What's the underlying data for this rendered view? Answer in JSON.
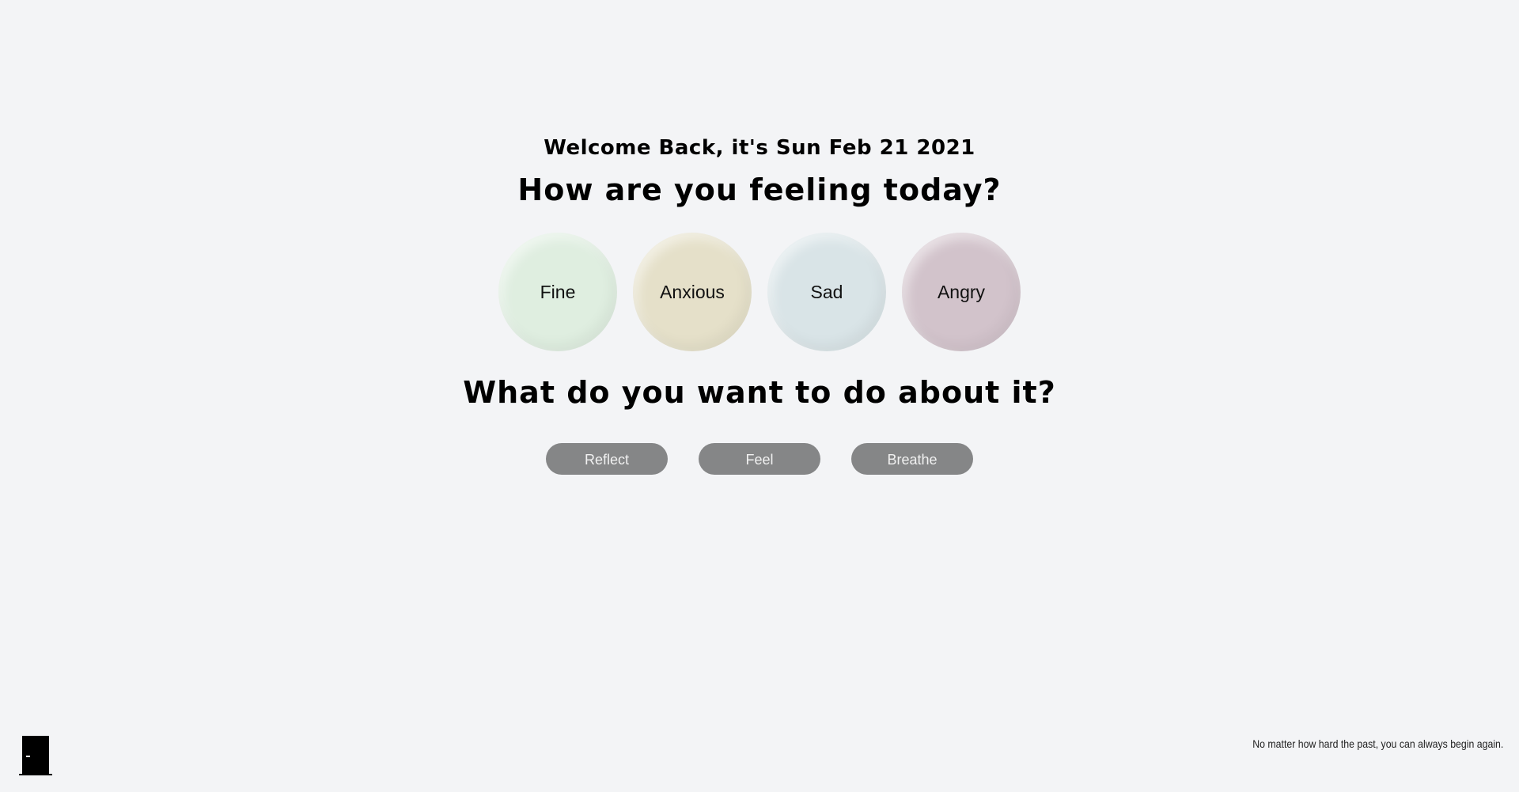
{
  "header": {
    "greeting": "Welcome Back, it's Sun Feb 21 2021",
    "feeling_question": "How are you feeling today?"
  },
  "moods": [
    {
      "label": "Fine",
      "color": "#dfeee0"
    },
    {
      "label": "Anxious",
      "color": "#e5e0c9"
    },
    {
      "label": "Sad",
      "color": "#d9e4e7"
    },
    {
      "label": "Angry",
      "color": "#d2c3cb"
    }
  ],
  "action_section": {
    "question": "What do you want to do about it?",
    "buttons": [
      {
        "label": "Reflect"
      },
      {
        "label": "Feel"
      },
      {
        "label": "Breathe"
      }
    ],
    "button_color": "#858687"
  },
  "footer": {
    "exit_icon": "door-icon",
    "quote": "No matter how hard the past, you can always begin again."
  }
}
